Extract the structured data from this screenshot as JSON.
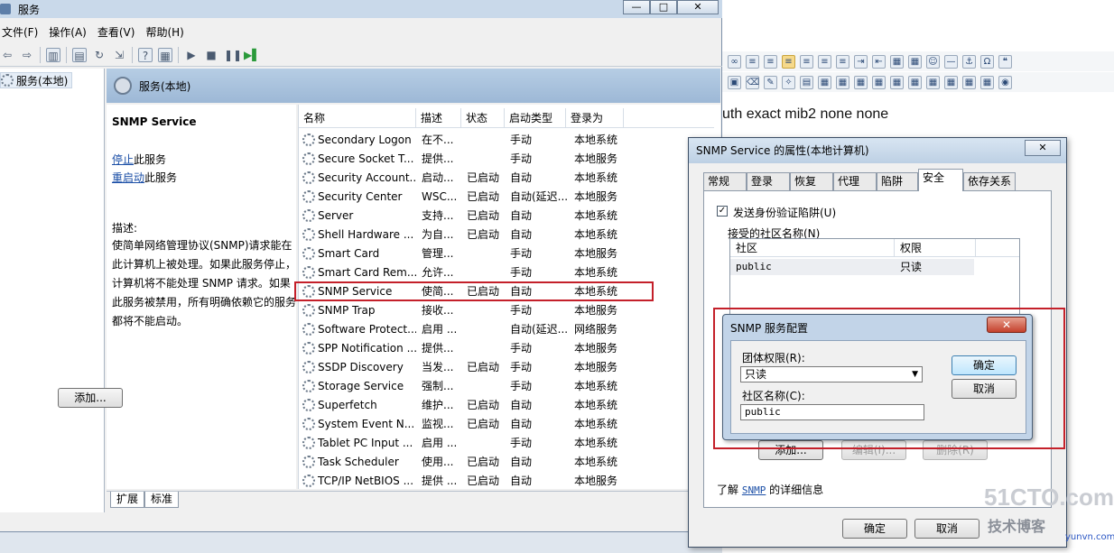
{
  "window": {
    "title": "服务",
    "menu": [
      "文件(F)",
      "操作(A)",
      "查看(V)",
      "帮助(H)"
    ],
    "min": "—",
    "max": "□",
    "close": "✕"
  },
  "tree": {
    "item": "服务(本地)"
  },
  "main": {
    "header": "服务(本地)",
    "service_title": "SNMP Service",
    "stop_link": "停止",
    "stop_rest": "此服务",
    "restart_link": "重启动",
    "restart_rest": "此服务",
    "desc_label": "描述:",
    "desc_body": "使简单网络管理协议(SNMP)请求能在此计算机上被处理。如果此服务停止，计算机将不能处理 SNMP 请求。如果此服务被禁用，所有明确依赖它的服务都将不能启动。"
  },
  "list": {
    "columns": [
      "名称",
      "描述",
      "状态",
      "启动类型",
      "登录为"
    ],
    "rows": [
      [
        "Secondary Logon",
        "在不...",
        "",
        "手动",
        "本地系统"
      ],
      [
        "Secure Socket T...",
        "提供...",
        "",
        "手动",
        "本地服务"
      ],
      [
        "Security Account...",
        "启动...",
        "已启动",
        "自动",
        "本地系统"
      ],
      [
        "Security Center",
        "WSC...",
        "已启动",
        "自动(延迟...",
        "本地服务"
      ],
      [
        "Server",
        "支持...",
        "已启动",
        "自动",
        "本地系统"
      ],
      [
        "Shell Hardware ...",
        "为自...",
        "已启动",
        "自动",
        "本地系统"
      ],
      [
        "Smart Card",
        "管理...",
        "",
        "手动",
        "本地服务"
      ],
      [
        "Smart Card Rem...",
        "允许...",
        "",
        "手动",
        "本地系统"
      ],
      [
        "SNMP Service",
        "使简...",
        "已启动",
        "自动",
        "本地系统"
      ],
      [
        "SNMP Trap",
        "接收...",
        "",
        "手动",
        "本地服务"
      ],
      [
        "Software Protect...",
        "启用 ...",
        "",
        "自动(延迟...",
        "网络服务"
      ],
      [
        "SPP Notification ...",
        "提供...",
        "",
        "手动",
        "本地服务"
      ],
      [
        "SSDP Discovery",
        "当发...",
        "已启动",
        "手动",
        "本地服务"
      ],
      [
        "Storage Service",
        "强制...",
        "",
        "手动",
        "本地系统"
      ],
      [
        "Superfetch",
        "维护...",
        "已启动",
        "自动",
        "本地系统"
      ],
      [
        "System Event N...",
        "监视...",
        "已启动",
        "自动",
        "本地系统"
      ],
      [
        "Tablet PC Input ...",
        "启用 ...",
        "",
        "手动",
        "本地系统"
      ],
      [
        "Task Scheduler",
        "使用...",
        "已启动",
        "自动",
        "本地系统"
      ],
      [
        "TCP/IP NetBIOS ...",
        "提供 ...",
        "已启动",
        "自动",
        "本地服务"
      ]
    ]
  },
  "bottom_tabs": [
    "扩展",
    "标准"
  ],
  "editor": {
    "text": "uth exact mib2 none none"
  },
  "properties": {
    "title": "SNMP Service 的属性(本地计算机)",
    "close": "✕",
    "tabs": [
      "常规",
      "登录",
      "恢复",
      "代理",
      "陷阱",
      "安全",
      "依存关系"
    ],
    "send_trap": "发送身份验证陷阱(U)",
    "accepted_label": "接受的社区名称(N)",
    "col_community": "社区",
    "col_rights": "权限",
    "community_row": [
      "public",
      "只读"
    ],
    "add_btn": "添加...",
    "edit_btn": "编辑(I)...",
    "remove_btn": "删除(R)",
    "learn_prefix": "了解",
    "learn_link": "SNMP",
    "learn_suffix": "的详细信息",
    "ok": "确定",
    "cancel": "取消"
  },
  "config": {
    "title": "SNMP 服务配置",
    "close": "✕",
    "rights_label": "团体权限(R):",
    "rights_value": "只读",
    "name_label": "社区名称(C):",
    "name_value": "public",
    "ok": "确定",
    "cancel": "取消"
  },
  "watermark": {
    "site": "51CTO.com",
    "sub": "技术博客",
    "url": "yunvn.com"
  }
}
